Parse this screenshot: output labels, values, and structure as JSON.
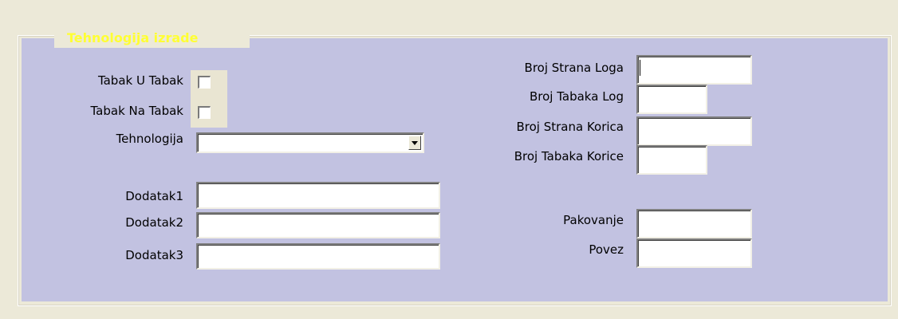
{
  "group": {
    "legend": "Tehnologija izrade"
  },
  "left": {
    "tabak_u_tabak_label": "Tabak U Tabak",
    "tabak_na_tabak_label": "Tabak Na Tabak",
    "tehnologija_label": "Tehnologija",
    "tehnologija_value": "",
    "dodatak1_label": "Dodatak1",
    "dodatak2_label": "Dodatak2",
    "dodatak3_label": "Dodatak3",
    "dodatak1_value": "",
    "dodatak2_value": "",
    "dodatak3_value": ""
  },
  "right": {
    "broj_strana_loga_label": "Broj Strana Loga",
    "broj_tabaka_log_label": "Broj Tabaka Log",
    "broj_strana_korica_label": "Broj Strana Korica",
    "broj_tabaka_korice_label": "Broj Tabaka Korice",
    "pakovanje_label": "Pakovanje",
    "povez_label": "Povez"
  },
  "icons": {
    "dropdown": "chevron-down-icon"
  },
  "colors": {
    "panel": "#C2C2E1",
    "legend_text": "#FFFF33",
    "window_bg": "#ECE9D8"
  }
}
